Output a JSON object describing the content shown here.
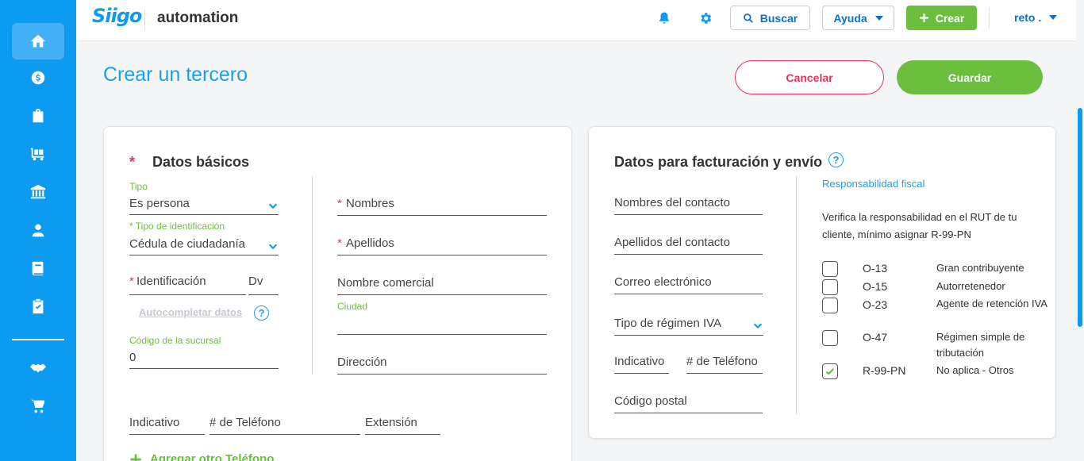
{
  "header": {
    "logo": "Siigo",
    "company": "automation",
    "search_label": "Buscar",
    "help_label": "Ayuda",
    "create_label": "Crear",
    "user_label": "reto ."
  },
  "sidebar": {
    "items": [
      "home-icon",
      "dollar-icon",
      "shopping-bag-icon",
      "truck-icon",
      "bank-icon",
      "user-icon",
      "book-icon",
      "clipboard-check-icon",
      "handshake-icon",
      "cart-icon"
    ]
  },
  "page": {
    "title": "Crear un tercero",
    "cancel_label": "Cancelar",
    "save_label": "Guardar"
  },
  "basic": {
    "required_mark": "*",
    "title": "Datos básicos",
    "tipo_label": "Tipo",
    "tipo_value": "Es persona",
    "id_type_label": "* Tipo de identificación",
    "id_type_value": "Cédula de ciudadanía",
    "identificacion_req": "*",
    "identificacion": "Identificación",
    "dv": "Dv",
    "autocompletar": "Autocompletar datos",
    "help": "?",
    "sucursal_label": "Código de la sucursal",
    "sucursal_value": "0",
    "nombres_req": "*",
    "nombres": "Nombres",
    "apellidos_req": "*",
    "apellidos": "Apellidos",
    "nombre_comercial": "Nombre comercial",
    "ciudad_label": "Ciudad",
    "direccion": "Dirección",
    "indicativo": "Indicativo",
    "telefono": "# de Teléfono",
    "extension": "Extensión",
    "add_phone": "Agregar otro Teléfono"
  },
  "billing": {
    "title": "Datos para facturación y envío",
    "help": "?",
    "contact_names": "Nombres del contacto",
    "contact_last": "Apellidos del contacto",
    "email": "Correo electrónico",
    "iva_regime": "Tipo de régimen IVA",
    "indicativo": "Indicativo",
    "telefono": "# de Teléfono",
    "postal": "Código postal",
    "fiscal_link": "Responsabilidad fiscal",
    "fiscal_note": "Verifica la responsabilidad en el RUT de tu cliente, mínimo asignar R-99-PN",
    "responsibilities": [
      {
        "code": "O-13",
        "desc": "Gran contribuyente",
        "checked": false
      },
      {
        "code": "O-15",
        "desc": "Autorretenedor",
        "checked": false
      },
      {
        "code": "O-23",
        "desc": "Agente de retención IVA",
        "checked": false
      },
      {
        "code": "O-47",
        "desc": "Régimen simple de tributación",
        "checked": false
      },
      {
        "code": "R-99-PN",
        "desc": "No aplica - Otros",
        "checked": true
      }
    ]
  },
  "colors": {
    "primary": "#0c9bf0",
    "green": "#6cbf3e",
    "danger": "#e8305a"
  }
}
